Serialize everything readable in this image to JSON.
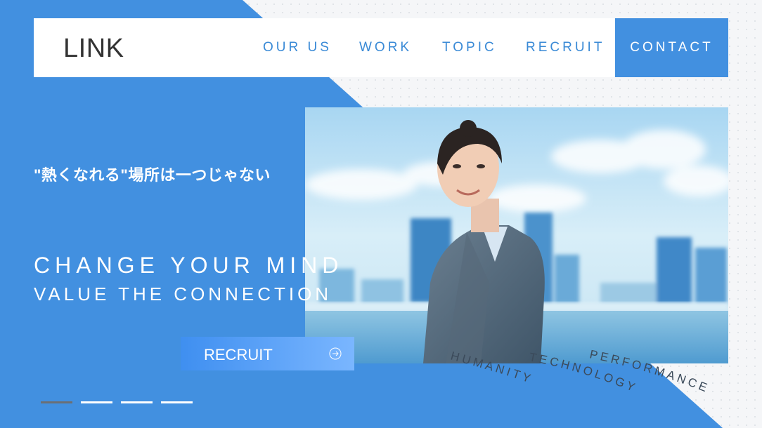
{
  "header": {
    "logo": "LINK",
    "nav": [
      "OUR US",
      "WORK",
      "TOPIC",
      "RECRUIT"
    ],
    "contact": "CONTACT"
  },
  "hero": {
    "tagline_jp": "\"熱くなれる\"場所は一つじゃない",
    "headline": "CHANGE YOUR MIND",
    "subheadline": "VALUE THE CONNECTION",
    "cta_label": "RECRUIT",
    "cta_icon": "arrow-circle-right-icon",
    "photo": "businesswoman-looking-up-city-skyline"
  },
  "keywords": [
    "HUMANITY",
    "TECHNOLOGY",
    "PERFORMANCE"
  ],
  "slider": {
    "count": 4,
    "active": 1
  },
  "colors": {
    "blue": "#4290e0",
    "link": "#3a8ad6",
    "white": "#ffffff",
    "text_dark": "#333333"
  }
}
